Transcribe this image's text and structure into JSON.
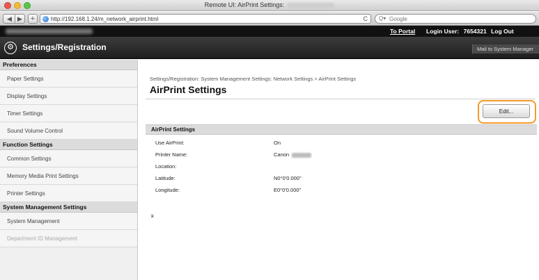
{
  "browser": {
    "window_title": "Remote UI: AirPrint Settings:",
    "back_icon": "◀",
    "forward_icon": "▶",
    "add_icon": "+",
    "url": "http://192.168.1.24/m_network_airprint.html",
    "reload_icon": "C",
    "search_placeholder": "Google",
    "search_icon": "Q▾"
  },
  "header": {
    "to_portal": "To Portal",
    "login_label": "Login User:",
    "login_user": "7654321",
    "logout": "Log Out",
    "gear_icon": "⚙",
    "app_title": "Settings/Registration",
    "mail_link": "Mail to System Manager"
  },
  "sidebar": {
    "sections": [
      {
        "title": "Preferences",
        "items": [
          "Paper Settings",
          "Display Settings",
          "Timer Settings",
          "Sound Volume Control"
        ]
      },
      {
        "title": "Function Settings",
        "items": [
          "Common Settings",
          "Memory Media Print Settings",
          "Printer Settings"
        ]
      },
      {
        "title": "System Management Settings",
        "items": [
          "System Management",
          "Department ID Management"
        ]
      }
    ]
  },
  "main": {
    "breadcrumb": "Settings/Registration: System Management Settings: Network Settings > AirPrint Settings",
    "title": "AirPrint Settings",
    "edit_button": "Edit...",
    "section_title": "AirPrint Settings",
    "rows": [
      {
        "label": "Use AirPrint:",
        "value": "On"
      },
      {
        "label": "Printer Name:",
        "value": "Canon"
      },
      {
        "label": "Location:",
        "value": ""
      },
      {
        "label": "Latitude:",
        "value": "N0°0'0.000\""
      },
      {
        "label": "Longitude:",
        "value": "E0°0'0.000\""
      }
    ],
    "to_top_icon": "⌅"
  },
  "colors": {
    "header_dark": "#1e1e1e",
    "highlight_ring": "#f39a2b",
    "sidebar_section": "#dcdcdc"
  }
}
